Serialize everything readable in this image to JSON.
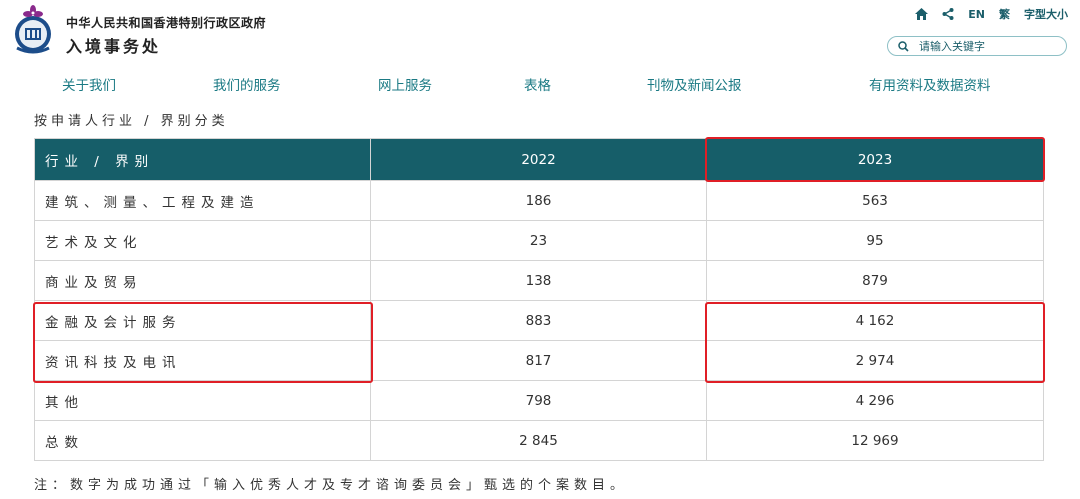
{
  "header": {
    "org_line1": "中华人民共和国香港特别行政区政府",
    "org_line2": "入境事务处",
    "logo_icon": "hk-immigration-emblem-icon"
  },
  "utility": {
    "home_icon": "home-icon",
    "share_icon": "share-icon",
    "lang_en": "EN",
    "lang_tc": "繁",
    "font_size": "字型大小"
  },
  "search": {
    "icon": "search-icon",
    "placeholder": "请输入关键字"
  },
  "nav": {
    "items": [
      {
        "label": "关于我们"
      },
      {
        "label": "我们的服务"
      },
      {
        "label": "网上服务"
      },
      {
        "label": "表格"
      },
      {
        "label": "刊物及新闻公报"
      },
      {
        "label": "有用资料及数据资料"
      }
    ]
  },
  "main": {
    "subtitle": "按申请人行业 / 界别分类",
    "table": {
      "headers": [
        "行业 / 界别",
        "2022",
        "2023"
      ],
      "rows": [
        [
          "建筑、测量、工程及建造",
          "186",
          "563"
        ],
        [
          "艺术及文化",
          "23",
          "95"
        ],
        [
          "商业及贸易",
          "138",
          "879"
        ],
        [
          "金融及会计服务",
          "883",
          "4 162"
        ],
        [
          "资讯科技及电讯",
          "817",
          "2 974"
        ],
        [
          "其他",
          "798",
          "4 296"
        ],
        [
          "总数",
          "2 845",
          "12 969"
        ]
      ]
    },
    "note": "注：数字为成功通过「输入优秀人才及专才谘询委员会」甄选的个案数目。"
  },
  "colors": {
    "header_bg": "#165e69",
    "nav_text": "#1b7a84",
    "highlight": "#e01f26"
  }
}
